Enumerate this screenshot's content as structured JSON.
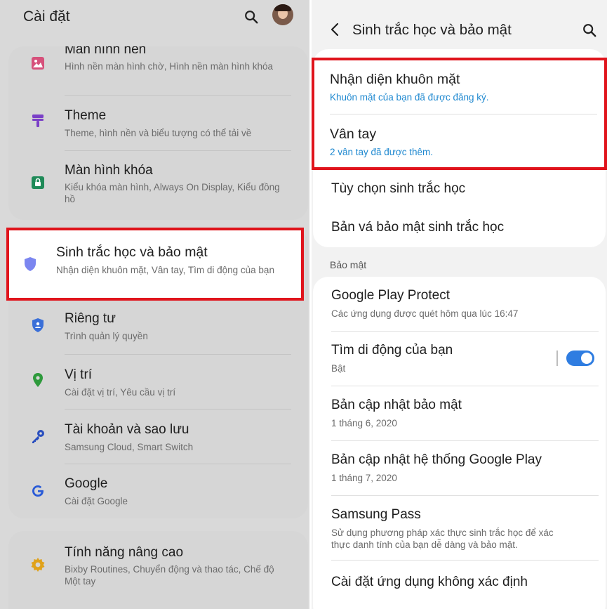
{
  "left": {
    "title": "Cài đặt",
    "items": [
      {
        "title": "Màn hình nền",
        "sub": "Hình nền màn hình chờ, Hình nền màn hình khóa"
      },
      {
        "title": "Theme",
        "sub": "Theme, hình nền và biểu tượng có thể tải về"
      },
      {
        "title": "Màn hình khóa",
        "sub": "Kiểu khóa màn hình, Always On Display, Kiểu đồng hồ"
      },
      {
        "title": "Sinh trắc học và bảo mật",
        "sub": "Nhận diện khuôn mặt, Vân tay, Tìm di động của bạn"
      },
      {
        "title": "Riêng tư",
        "sub": "Trình quản lý quyền"
      },
      {
        "title": "Vị trí",
        "sub": "Cài đặt vị trí, Yêu cầu vị trí"
      },
      {
        "title": "Tài khoản và sao lưu",
        "sub": "Samsung Cloud, Smart Switch"
      },
      {
        "title": "Google",
        "sub": "Cài đặt Google"
      },
      {
        "title": "Tính năng nâng cao",
        "sub": "Bixby Routines, Chuyển động và thao tác, Chế độ Một tay"
      }
    ]
  },
  "right": {
    "title": "Sinh trắc học và bảo mật",
    "items": [
      {
        "title": "Nhận diện khuôn mặt",
        "sub": "Khuôn mặt của bạn đã được đăng ký."
      },
      {
        "title": "Vân tay",
        "sub": "2 vân tay đã được thêm."
      },
      {
        "title": "Tùy chọn sinh trắc học"
      },
      {
        "title": "Bản vá bảo mật sinh trắc học"
      }
    ],
    "section_label": "Bảo mật",
    "security_items": [
      {
        "title": "Google Play Protect",
        "sub": "Các ứng dụng được quét hôm qua lúc 16:47"
      },
      {
        "title": "Tìm di động của bạn",
        "sub": "Bật"
      },
      {
        "title": "Bản cập nhật bảo mật",
        "sub": "1 tháng 6, 2020"
      },
      {
        "title": "Bản cập nhật hệ thống Google Play",
        "sub": "1 tháng 7, 2020"
      },
      {
        "title": "Samsung Pass",
        "sub": "Sử dụng phương pháp xác thực sinh trắc học để xác thực danh tính của bạn dễ dàng và bảo mật."
      },
      {
        "title": "Cài đặt ứng dụng không xác định"
      }
    ],
    "find_my_mobile_enabled": true
  },
  "colors": {
    "highlight": "#e0141c",
    "accent_blue": "#1e88d0",
    "toggle_on": "#2f7de1"
  }
}
